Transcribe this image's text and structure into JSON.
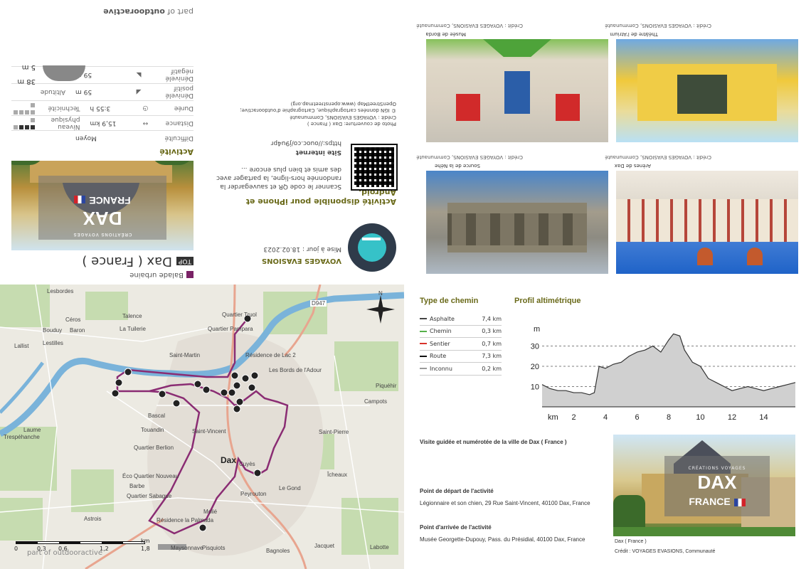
{
  "branding": {
    "part_of": "part of",
    "brand": "outdooractive"
  },
  "header": {
    "category": "Balade urbaine",
    "top_badge": "TOP",
    "title": "Dax ( France )"
  },
  "cover": {
    "subtitle": "CRÉATIONS VOYAGES",
    "city": "DAX",
    "country": "FRANCE"
  },
  "activity": {
    "section_title": "Activité",
    "rows": [
      {
        "label": "Difficulté",
        "value": "Moyen"
      },
      {
        "label": "Distance",
        "value": "15,9 km"
      },
      {
        "label": "Durée",
        "value": "3:55 h"
      },
      {
        "label": "Dénivelé positif",
        "value": "59 m"
      },
      {
        "label": "Dénivelé négatif",
        "value": "59 m"
      }
    ],
    "physical_label": "Niveau physique",
    "technique_label": "Technicité",
    "physical_level": 3,
    "technique_level": 0,
    "altitude_label": "Altitude",
    "alt_max": "38 m",
    "alt_min": "5 m"
  },
  "middle": {
    "credit_title": "Crédit :",
    "credit_lines": [
      "Photo de couverture: Dax ( France )",
      "Crédit : VOYAGES EVASIONS, Communauté",
      "© IGN données cartographique, Cartographie d'outdooractive;",
      "OpenStreetMap (www.openstreetmap.org)"
    ],
    "site_label": "Site internet",
    "site_url": "https://ouoc.co/j9u4pr",
    "app_title": "Activité disponible pour iPhone et Android.",
    "app_text_1": "Scanner le code QR et sauvegarder la",
    "app_text_2": "randonnée hors-ligne, la partager avec",
    "app_text_3": "des amis et bien plus encore ...",
    "org": "VOYAGES EVASIONS",
    "updated": "Mise à jour : 18.02.2023"
  },
  "photos": [
    {
      "caption": "Musée de Borda",
      "credit": "Crédit : VOYAGES EVASIONS, Communauté"
    },
    {
      "caption": "Théâtre de l'Atrium",
      "credit": "Crédit : VOYAGES EVASIONS, Communauté"
    },
    {
      "caption": "Source de la Néhe",
      "credit": "Crédit : VOYAGES EVASIONS, Communauté"
    },
    {
      "caption": "Arènes de Dax",
      "credit": "Crédit : VOYAGES EVASIONS, Communauté"
    }
  ],
  "map": {
    "labels": {
      "lesbordes": "Lesbordes",
      "talence": "Talence",
      "bouduy": "Bouduy",
      "ceros": "Céros",
      "lestilles": "Lestilles",
      "baron": "Baron",
      "tuilerie": "La Tuilerie",
      "lalist": "Lallist",
      "haut": "Quartier Truol",
      "pampara": "Quartier Pampara",
      "saintmartin": "Saint-Martin",
      "rdelle": "Résidence de Lac 2",
      "bords": "Les Bords de l'Adour",
      "piquehir": "Piquéhir",
      "campots": "Campots",
      "bascal": "Bascal",
      "touandin": "Touandin",
      "saintvincent": "Saint-Vincent",
      "stpierre": "Saint-Pierre",
      "laume": "Laume",
      "tresplanche": "Trespéhanche",
      "berlion": "Quartier Berlion",
      "ecoquartier": "Éco Quartier Nouveau",
      "dax": "Dax",
      "cuyes": "Cuyès",
      "barbe": "Barbe",
      "sabague": "Quartier Sabague",
      "peyrouton": "Peyrouton",
      "mozlé": "Molié",
      "residence": "Résidence la Palmada",
      "astrois": "Astrois",
      "maysonnave": "Maysonnave",
      "pisquiots": "Pisquiots",
      "jacquet": "Jacquet",
      "bagnoles": "Bagnoles",
      "labotte": "Labotte",
      "d947": "D947",
      "n": "N",
      "dourg": "Le Gond",
      "iceaux": "Îcheaux"
    },
    "scale_ticks": [
      "0",
      "0,3",
      "0,6",
      "",
      "1,2",
      "1,8"
    ],
    "scale_unit": "km",
    "watermark": "part of outdooractive"
  },
  "path_types": {
    "title": "Type de chemin",
    "items": [
      {
        "name": "Asphalte",
        "km": "7,4 km",
        "color": "#444444"
      },
      {
        "name": "Chemin",
        "km": "0,3 km",
        "color": "#56b04a"
      },
      {
        "name": "Sentier",
        "km": "0,7 km",
        "color": "#d8332b"
      },
      {
        "name": "Route",
        "km": "7,3 km",
        "color": "#111111"
      },
      {
        "name": "Inconnu",
        "km": "0,2 km",
        "color": "#999999"
      }
    ]
  },
  "chart_data": {
    "type": "area",
    "title": "Profil altimétrique",
    "ylabel": "m",
    "xlabel": "km",
    "ylim": [
      0,
      40
    ],
    "xlim": [
      0,
      16
    ],
    "yticks": [
      10,
      20,
      30
    ],
    "xticks": [
      2,
      4,
      6,
      8,
      10,
      12,
      14
    ],
    "x": [
      0,
      0.5,
      1,
      1.5,
      2,
      2.5,
      3,
      3.3,
      3.6,
      4,
      4.5,
      5,
      5.5,
      6,
      6.5,
      7,
      7.5,
      8,
      8.3,
      8.7,
      9,
      9.5,
      10,
      10.5,
      11,
      11.5,
      12,
      12.5,
      13,
      13.5,
      14,
      14.5,
      15,
      15.5,
      16
    ],
    "y": [
      11,
      9,
      8,
      8,
      7,
      7,
      6,
      7,
      20,
      19,
      21,
      22,
      25,
      27,
      28,
      30,
      27,
      33,
      36,
      35,
      28,
      22,
      20,
      14,
      12,
      10,
      8,
      9,
      10,
      9,
      8,
      9,
      10,
      11,
      12
    ],
    "grid": true,
    "fill_color": "#d0d0d0",
    "line_color": "#333333"
  },
  "info": {
    "intro": "Visite guidée et numérotée de la ville de Dax ( France )",
    "start_title": "Point de départ de l'activité",
    "start_text": "Légionnaire et son chien, 29 Rue Saint-Vincent, 40100 Dax, France",
    "end_title": "Point d'arrivée de l'activité",
    "end_text": "Musée Georgette-Dupouy, Pass. du Présidial, 40100 Dax, France"
  },
  "church": {
    "subtitle": "CRÉATIONS VOYAGES",
    "city": "DAX",
    "country": "FRANCE",
    "caption": "Dax ( France )",
    "credit": "Crédit : VOYAGES EVASIONS, Communauté"
  }
}
